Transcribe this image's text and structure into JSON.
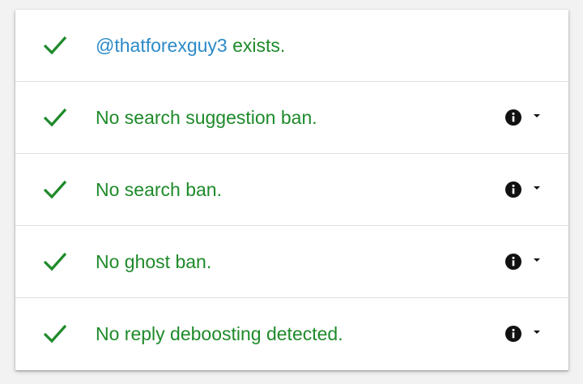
{
  "theme": {
    "success_color": "#1e8a2a",
    "link_color": "#2b8ac7"
  },
  "results": [
    {
      "icon": "check-icon",
      "handle": "@thatforexguy3",
      "text": " exists.",
      "has_details": false
    },
    {
      "icon": "check-icon",
      "text": "No search suggestion ban.",
      "has_details": true,
      "details_icon": "info-icon"
    },
    {
      "icon": "check-icon",
      "text": "No search ban.",
      "has_details": true,
      "details_icon": "info-icon"
    },
    {
      "icon": "check-icon",
      "text": "No ghost ban.",
      "has_details": true,
      "details_icon": "info-icon"
    },
    {
      "icon": "check-icon",
      "text": "No reply deboosting detected.",
      "has_details": true,
      "details_icon": "info-icon"
    }
  ]
}
